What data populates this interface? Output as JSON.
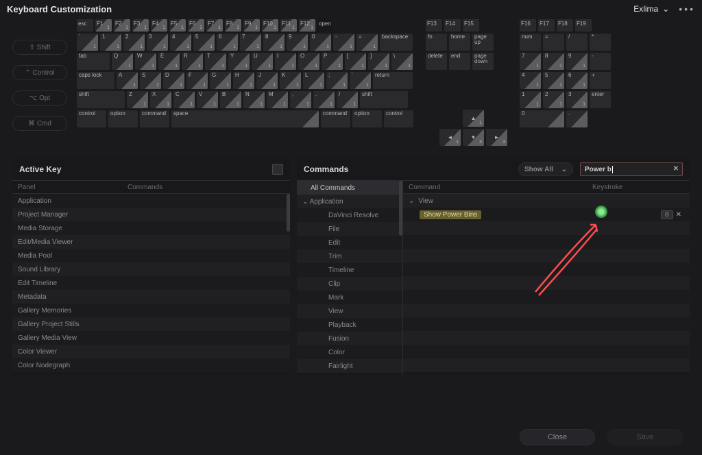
{
  "titlebar": {
    "title": "Keyboard Customization",
    "preset": "Exlima",
    "more_icon": "more-horizontal-icon"
  },
  "modifiers": [
    {
      "icon": "⇧",
      "label": "Shift"
    },
    {
      "icon": "⌃",
      "label": "Control"
    },
    {
      "icon": "⌥",
      "label": "Opt"
    },
    {
      "icon": "⌘",
      "label": "Cmd"
    }
  ],
  "active_key_panel": {
    "title": "Active Key",
    "col_panel": "Panel",
    "col_commands": "Commands",
    "rows": [
      "Application",
      "Project Manager",
      "Media Storage",
      "Edit/Media Viewer",
      "Media Pool",
      "Sound Library",
      "Edit Timeline",
      "Metadata",
      "Gallery Memories",
      "Gallery Project Stills",
      "Gallery Media View",
      "Color Viewer",
      "Color Nodegraph"
    ]
  },
  "commands_panel": {
    "title": "Commands",
    "dropdown": "Show All",
    "search_value": "Power b",
    "tree": [
      {
        "label": "All Commands",
        "sel": true
      },
      {
        "label": "Application",
        "expanded": true,
        "children": [
          "DaVinci Resolve",
          "File",
          "Edit",
          "Trim",
          "Timeline",
          "Clip",
          "Mark",
          "View",
          "Playback",
          "Fusion",
          "Color",
          "Fairlight"
        ]
      }
    ],
    "col_command": "Command",
    "col_keystroke": "Keystroke",
    "result_group": "View",
    "result_item": "Show Power Bins",
    "result_key": "8"
  },
  "footer": {
    "close": "Close",
    "save": "Save"
  },
  "keyboard": {
    "fn_row": [
      "esc",
      "F1",
      "F2",
      "F3",
      "F4",
      "F5",
      "F6",
      "F7",
      "F8",
      "F9",
      "F10",
      "F11",
      "F12",
      "open"
    ],
    "fn_right1": [
      "F13",
      "F14",
      "F15"
    ],
    "fn_right2": [
      "F16",
      "F17",
      "F18",
      "F19"
    ],
    "row1": [
      [
        "`",
        "1"
      ],
      [
        "1",
        "1"
      ],
      [
        "2",
        "1"
      ],
      [
        "3",
        "1"
      ],
      [
        "4",
        "1"
      ],
      [
        "5",
        "1"
      ],
      [
        "6",
        "1"
      ],
      [
        "7",
        "1"
      ],
      [
        "8",
        "1"
      ],
      [
        "9",
        "1"
      ],
      [
        "0",
        "1"
      ],
      [
        "-",
        "1"
      ],
      [
        "=",
        "1"
      ]
    ],
    "row1_bksp": "backspace",
    "row2_tab": "tab",
    "row2": [
      [
        "Q",
        "1"
      ],
      [
        "W",
        "1"
      ],
      [
        "E",
        "1"
      ],
      [
        "R",
        "1"
      ],
      [
        "T",
        "1"
      ],
      [
        "Y",
        "1"
      ],
      [
        "U",
        "1"
      ],
      [
        "I",
        "1"
      ],
      [
        "O",
        "1"
      ],
      [
        "P",
        "1"
      ],
      [
        "[",
        "1"
      ],
      [
        "]",
        "1"
      ],
      [
        "\\",
        "1"
      ]
    ],
    "row3_caps": "caps lock",
    "row3": [
      [
        "A",
        "1"
      ],
      [
        "S",
        "1"
      ],
      [
        "D",
        "1"
      ],
      [
        "F",
        "1"
      ],
      [
        "G",
        "1"
      ],
      [
        "H",
        "1"
      ],
      [
        "J",
        "1"
      ],
      [
        "K",
        "1"
      ],
      [
        "L",
        "1"
      ],
      [
        ";",
        "1"
      ],
      [
        "'",
        "1"
      ]
    ],
    "row3_ret": "return",
    "row4_shift": "shift",
    "row4": [
      [
        "Z",
        "1"
      ],
      [
        "X",
        "1"
      ],
      [
        "C",
        "1"
      ],
      [
        "V",
        "1"
      ],
      [
        "B",
        "1"
      ],
      [
        "N",
        "1"
      ],
      [
        "M",
        "1"
      ],
      [
        ",",
        "1"
      ],
      [
        ".",
        "1"
      ],
      [
        "/",
        "1"
      ]
    ],
    "row4_shift_r": "shift",
    "row5": [
      "control",
      "option",
      "command"
    ],
    "row5_space": "space",
    "row5_r": [
      "command",
      "option",
      "control"
    ],
    "nav_r1": [
      "fn",
      "home",
      "page up"
    ],
    "nav_r2": [
      "delete",
      "end",
      "page down"
    ],
    "arrows": [
      "▲",
      "◄",
      "▼",
      "►"
    ],
    "numpad_r1": [
      "num",
      "=",
      "/",
      "*"
    ],
    "numpad_r2": [
      [
        "7",
        "1"
      ],
      [
        "8",
        "1"
      ],
      [
        "9",
        "1"
      ]
    ],
    "numpad_minus": "-",
    "numpad_r3": [
      [
        "4",
        "1"
      ],
      [
        "5",
        "1"
      ],
      [
        "6",
        "1"
      ]
    ],
    "numpad_plus": "+",
    "numpad_r4": [
      [
        "1",
        "1"
      ],
      [
        "2",
        "1"
      ],
      [
        "3",
        "1"
      ]
    ],
    "numpad_enter": "enter",
    "numpad_r5": [
      "0",
      "."
    ]
  }
}
